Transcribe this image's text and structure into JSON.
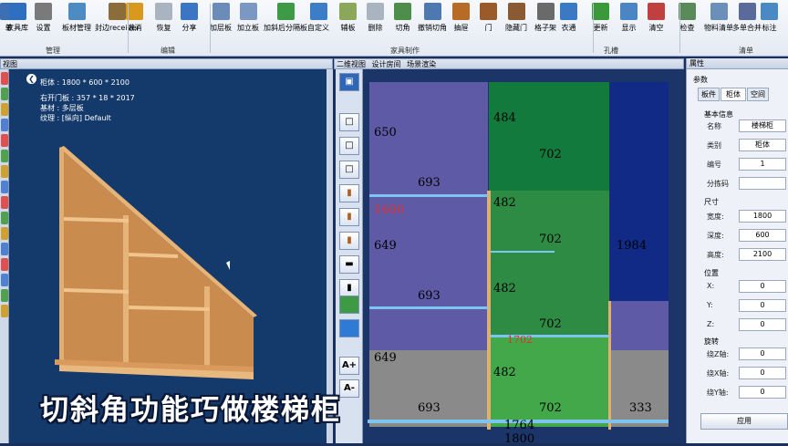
{
  "ribbon": {
    "buttons": [
      {
        "label": "单",
        "icon": "doc-icon",
        "color": "#3d6fb5"
      },
      {
        "label": "家具库",
        "icon": "grid-icon",
        "color": "#2f6fc0"
      },
      {
        "label": "设置",
        "icon": "gear-icon",
        "color": "#7a7a7a"
      },
      {
        "label": "板材管理",
        "icon": "stack-icon",
        "color": "#4d8bc4"
      },
      {
        "label": "封边receiver",
        "icon": "edge-icon",
        "color": "#8a6d3b"
      },
      {
        "label": "撤消",
        "icon": "undo-icon",
        "color": "#d89a1c"
      },
      {
        "label": "恢复",
        "icon": "redo-icon",
        "color": "#aab3c0"
      },
      {
        "label": "分享",
        "icon": "share-icon",
        "color": "#3a76c4"
      },
      {
        "label": "加层板",
        "icon": "shelf-icon",
        "color": "#6b8cb8"
      },
      {
        "label": "加立板",
        "icon": "panel-icon",
        "color": "#7a98c2"
      },
      {
        "label": "加斜后分隔板",
        "icon": "cube-icon",
        "color": "#3f9a45"
      },
      {
        "label": "自定义",
        "icon": "custom-icon",
        "color": "#3c7dc8"
      },
      {
        "label": "辅板",
        "icon": "board-icon",
        "color": "#8ba85a"
      },
      {
        "label": "删除",
        "icon": "delete-icon",
        "color": "#aab3c0"
      },
      {
        "label": "切角",
        "icon": "corner-icon",
        "color": "#4d8f4a"
      },
      {
        "label": "撤销切角",
        "icon": "undo-corner-icon",
        "color": "#4c79b0"
      },
      {
        "label": "抽屉",
        "icon": "drawer-icon",
        "color": "#b86b26"
      },
      {
        "label": "门",
        "icon": "door-icon",
        "color": "#9a5a2a"
      },
      {
        "label": "隐藏门",
        "icon": "hidden-door-icon",
        "color": "#8a5a32"
      },
      {
        "label": "格子架",
        "icon": "lattice-icon",
        "color": "#6a6a6a"
      },
      {
        "label": "衣通",
        "icon": "rail-icon",
        "color": "#3a7ac4"
      },
      {
        "label": "更新",
        "icon": "refresh-icon",
        "color": "#3a9a3a"
      },
      {
        "label": "显示",
        "icon": "display-icon",
        "color": "#4a86c6"
      },
      {
        "label": "清空",
        "icon": "clear-icon",
        "color": "#c04040"
      },
      {
        "label": "检查",
        "icon": "check-icon",
        "color": "#5a8a5a"
      },
      {
        "label": "物料清单",
        "icon": "list-icon",
        "color": "#6a8fb8"
      },
      {
        "label": "多单合并",
        "icon": "merge-icon",
        "color": "#5a6a9a"
      },
      {
        "label": "标注",
        "icon": "mark-icon",
        "color": "#4a8ac4"
      }
    ],
    "groups": [
      "管理",
      "编辑",
      "家具制作",
      "孔槽",
      "清单"
    ]
  },
  "panels": {
    "view3d_title": "视图",
    "view2d_tabs": [
      "二维视图",
      "设计房间",
      "场景渲染"
    ],
    "props_title": "属性"
  },
  "cabinet_info": {
    "name": "柜体 : 1800 * 600 * 2100",
    "door": "右开门板 : 357 * 18 * 2017",
    "material": "基材 : 多层板",
    "grain": "纹理 : [纵向] Default"
  },
  "dims": [
    "650",
    "693",
    "484",
    "702",
    "1600",
    "482",
    "649",
    "702",
    "1984",
    "693",
    "482",
    "702",
    "1702",
    "649",
    "482",
    "693",
    "702",
    "333",
    "1764",
    "1800"
  ],
  "tools2d": [
    "A+",
    "A-"
  ],
  "props": {
    "section_params": "参数",
    "tabs": [
      "板件",
      "柜体",
      "空间"
    ],
    "basic": "基本信息",
    "fields": [
      {
        "label": "名称",
        "value": "楼梯柜"
      },
      {
        "label": "类别",
        "value": "柜体"
      },
      {
        "label": "编号",
        "value": "1"
      },
      {
        "label": "分拣码",
        "value": ""
      }
    ],
    "size": "尺寸",
    "size_fields": [
      {
        "label": "宽度:",
        "value": "1800"
      },
      {
        "label": "深度:",
        "value": "600"
      },
      {
        "label": "高度:",
        "value": "2100"
      }
    ],
    "pos": "位置",
    "pos_fields": [
      {
        "label": "X:",
        "value": "0"
      },
      {
        "label": "Y:",
        "value": "0"
      },
      {
        "label": "Z:",
        "value": "0"
      }
    ],
    "rot": "旋转",
    "rot_fields": [
      {
        "label": "绕Z轴:",
        "value": "0"
      },
      {
        "label": "绕X轴:",
        "value": "0"
      },
      {
        "label": "绕Y轴:",
        "value": "0"
      }
    ],
    "apply": "应用"
  },
  "caption": "切斜角功能巧做楼梯柜",
  "colors": {
    "view3d": "#14396b",
    "wood": "#d9a062",
    "purple": "#5e5aa6",
    "green": "#2e8b44",
    "navy": "#102a86",
    "gray": "#8a8a8a"
  }
}
